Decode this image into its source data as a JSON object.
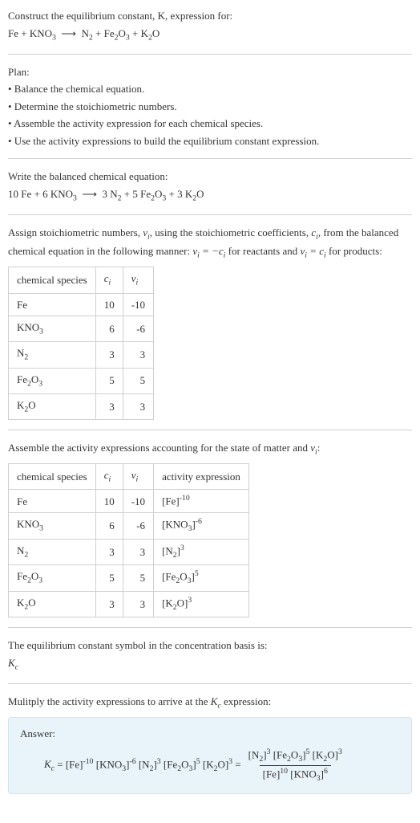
{
  "header": {
    "title_text": "Construct the equilibrium constant, K, expression for:",
    "equation": "Fe + KNO₃  ⟶  N₂ + Fe₂O₃ + K₂O"
  },
  "plan": {
    "label": "Plan:",
    "items": [
      "• Balance the chemical equation.",
      "• Determine the stoichiometric numbers.",
      "• Assemble the activity expression for each chemical species.",
      "• Use the activity expressions to build the equilibrium constant expression."
    ]
  },
  "balanced": {
    "intro": "Write the balanced chemical equation:",
    "equation": "10 Fe + 6 KNO₃  ⟶  3 N₂ + 5 Fe₂O₃ + 3 K₂O"
  },
  "assign": {
    "text_parts": {
      "p1": "Assign stoichiometric numbers, ",
      "nu_i": "νᵢ",
      "p2": ", using the stoichiometric coefficients, ",
      "c_i": "cᵢ",
      "p3": ", from the balanced chemical equation in the following manner: ",
      "rel1": "νᵢ = −cᵢ",
      "p4": " for reactants and ",
      "rel2": "νᵢ = cᵢ",
      "p5": " for products:"
    },
    "table": {
      "headers": [
        "chemical species",
        "cᵢ",
        "νᵢ"
      ],
      "rows": [
        {
          "species": "Fe",
          "c": "10",
          "nu": "-10"
        },
        {
          "species": "KNO₃",
          "c": "6",
          "nu": "-6"
        },
        {
          "species": "N₂",
          "c": "3",
          "nu": "3"
        },
        {
          "species": "Fe₂O₃",
          "c": "5",
          "nu": "5"
        },
        {
          "species": "K₂O",
          "c": "3",
          "nu": "3"
        }
      ]
    }
  },
  "activity": {
    "intro_p1": "Assemble the activity expressions accounting for the state of matter and ",
    "intro_nu": "νᵢ",
    "intro_p2": ":",
    "table": {
      "headers": [
        "chemical species",
        "cᵢ",
        "νᵢ",
        "activity expression"
      ],
      "rows": [
        {
          "species": "Fe",
          "c": "10",
          "nu": "-10",
          "expr": "[Fe]⁻¹⁰"
        },
        {
          "species": "KNO₃",
          "c": "6",
          "nu": "-6",
          "expr": "[KNO₃]⁻⁶"
        },
        {
          "species": "N₂",
          "c": "3",
          "nu": "3",
          "expr": "[N₂]³"
        },
        {
          "species": "Fe₂O₃",
          "c": "5",
          "nu": "5",
          "expr": "[Fe₂O₃]⁵"
        },
        {
          "species": "K₂O",
          "c": "3",
          "nu": "3",
          "expr": "[K₂O]³"
        }
      ]
    }
  },
  "symbol": {
    "line1": "The equilibrium constant symbol in the concentration basis is:",
    "line2": "K_c"
  },
  "multiply": {
    "intro_p1": "Mulitply the activity expressions to arrive at the ",
    "kc": "K_c",
    "intro_p2": " expression:"
  },
  "answer": {
    "label": "Answer:",
    "lhs": "K_c = [Fe]⁻¹⁰ [KNO₃]⁻⁶ [N₂]³ [Fe₂O₃]⁵ [K₂O]³ = ",
    "frac_num": "[N₂]³ [Fe₂O₃]⁵ [K₂O]³",
    "frac_den": "[Fe]¹⁰ [KNO₃]⁶"
  }
}
